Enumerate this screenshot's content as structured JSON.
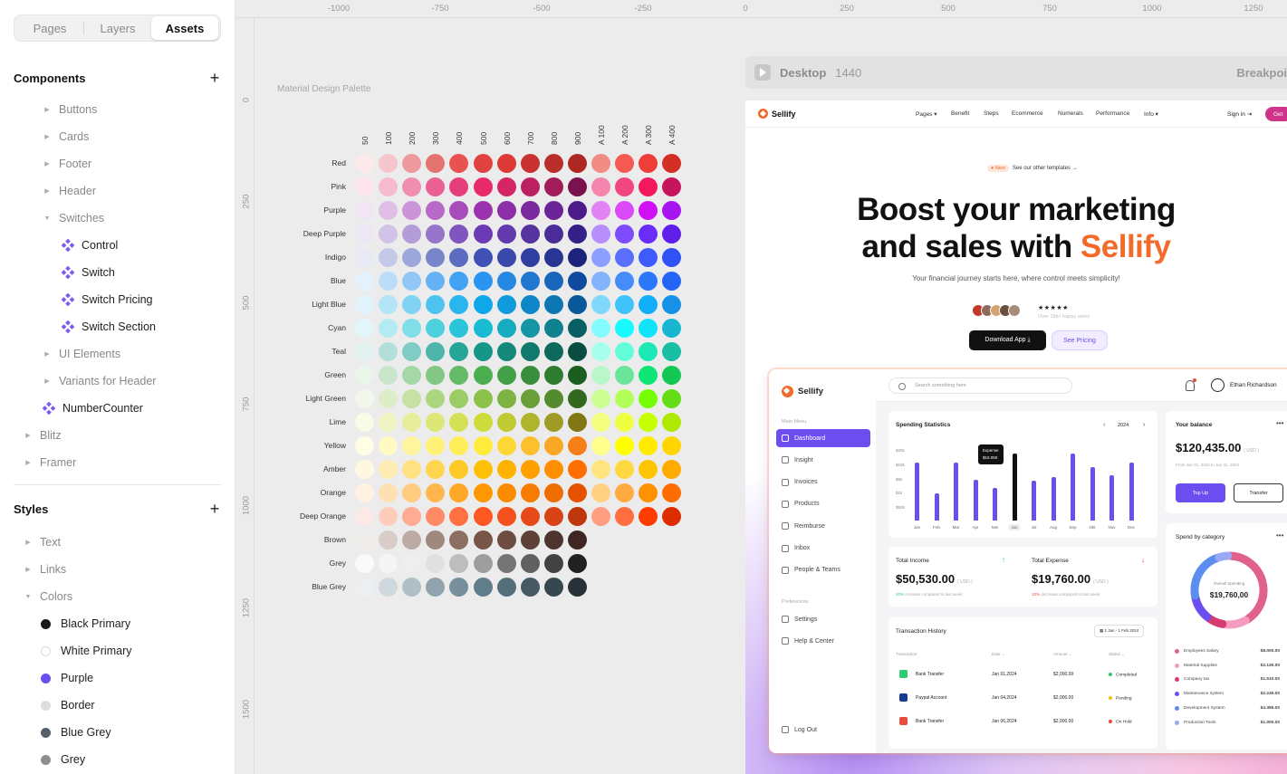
{
  "tabs": [
    "Pages",
    "Layers",
    "Assets"
  ],
  "active_tab": "Assets",
  "components": {
    "title": "Components",
    "items": [
      {
        "label": "Buttons"
      },
      {
        "label": "Cards"
      },
      {
        "label": "Footer"
      },
      {
        "label": "Header"
      },
      {
        "label": "Switches",
        "expanded": true
      },
      {
        "label": "Control"
      },
      {
        "label": "Switch"
      },
      {
        "label": "Switch Pricing"
      },
      {
        "label": "Switch Section"
      },
      {
        "label": "UI Elements"
      },
      {
        "label": "Variants for Header"
      },
      {
        "label": "NumberCounter"
      },
      {
        "label": "Blitz"
      },
      {
        "label": "Framer"
      }
    ]
  },
  "styles": {
    "title": "Styles",
    "items": [
      {
        "label": "Text"
      },
      {
        "label": "Links"
      },
      {
        "label": "Colors",
        "expanded": true
      },
      {
        "label": "Black Primary",
        "color": "#1a1a1a"
      },
      {
        "label": "White Primary",
        "color": "#ffffff"
      },
      {
        "label": "Purple",
        "color": "#6c4ef0"
      },
      {
        "label": "Border",
        "color": "#dedede"
      },
      {
        "label": "Blue Grey",
        "color": "#56606b"
      },
      {
        "label": "Grey",
        "color": "#8e8e8e"
      }
    ]
  },
  "ruler": {
    "top": [
      "-1000",
      "-750",
      "-500",
      "-250",
      "0",
      "250",
      "500",
      "750",
      "1000",
      "1250"
    ],
    "left": [
      "0",
      "250",
      "500",
      "750",
      "1000",
      "1250",
      "1500"
    ]
  },
  "palette": {
    "title": "Material Design Palette",
    "columns": [
      "50",
      "100",
      "200",
      "300",
      "400",
      "500",
      "600",
      "700",
      "800",
      "900",
      "A 100",
      "A 200",
      "A 300",
      "A 400"
    ],
    "rows": [
      {
        "name": "Red",
        "colors": [
          "#fde9ea",
          "#f5c6cb",
          "#ec9a9d",
          "#e47370",
          "#e8534f",
          "#e0433f",
          "#dd3935",
          "#c93231",
          "#b92e2b",
          "#ad2823",
          "#f08c84",
          "#f55a52",
          "#ef3e3a",
          "#d42f24"
        ]
      },
      {
        "name": "Pink",
        "colors": [
          "#fce3ec",
          "#f6bbd0",
          "#f08eb0",
          "#ea6093",
          "#e63d7c",
          "#e62a6a",
          "#d42565",
          "#bc2060",
          "#a31b59",
          "#79124d",
          "#f585ac",
          "#f1467e",
          "#f2195f",
          "#c6155c"
        ]
      },
      {
        "name": "Purple",
        "colors": [
          "#f1e4f4",
          "#e0bee6",
          "#cc94d8",
          "#b76ac7",
          "#a84cbb",
          "#9a33ad",
          "#8b2ea8",
          "#7a299f",
          "#6a2498",
          "#4d1a89",
          "#e382f5",
          "#db49f8",
          "#d10ff5",
          "#a814f1"
        ]
      },
      {
        "name": "Deep Purple",
        "colors": [
          "#ece6f5",
          "#d0c3e7",
          "#b39cd8",
          "#9575ca",
          "#7f56c0",
          "#6b3ab4",
          "#623aae",
          "#56339f",
          "#4b2d99",
          "#351f89",
          "#b78efc",
          "#7d4cfb",
          "#6a2cf8",
          "#5f1eea"
        ]
      },
      {
        "name": "Indigo",
        "colors": [
          "#e7e9f5",
          "#c4c9e8",
          "#9ea7d9",
          "#7985cb",
          "#5d6bc0",
          "#3f51b5",
          "#3a48ab",
          "#303f9f",
          "#283593",
          "#1b237d",
          "#8c9eff",
          "#5a6ffc",
          "#3d5bfe",
          "#3051f5"
        ]
      },
      {
        "name": "Blue",
        "colors": [
          "#e3f1fd",
          "#bcdcf9",
          "#91c7f7",
          "#64b2f4",
          "#42a2f3",
          "#2a94f2",
          "#2588e3",
          "#1f77d0",
          "#1966bd",
          "#104a9e",
          "#83b3fc",
          "#458cfa",
          "#2a79fc",
          "#2564f6"
        ]
      },
      {
        "name": "Light Blue",
        "colors": [
          "#e1f4fb",
          "#b3e4f7",
          "#80d3f3",
          "#4fc3f0",
          "#29b5ed",
          "#0ea8ea",
          "#0f9adb",
          "#0d87c7",
          "#0c77b3",
          "#08589a",
          "#80d7fc",
          "#3fc3fb",
          "#12aef8",
          "#1691e8"
        ]
      },
      {
        "name": "Cyan",
        "colors": [
          "#e0f6f8",
          "#b2ebf1",
          "#80dee8",
          "#4fd0df",
          "#2ac5d8",
          "#17bbd2",
          "#16abbf",
          "#1496a6",
          "#10828e",
          "#085f64",
          "#84fcfe",
          "#19fafe",
          "#11e3fb",
          "#17b7d1"
        ]
      },
      {
        "name": "Teal",
        "colors": [
          "#e1f2f1",
          "#b3dfdb",
          "#80cbc4",
          "#4eb5ab",
          "#26a699",
          "#149688",
          "#13887b",
          "#10796b",
          "#0d695c",
          "#084d40",
          "#a7ffeb",
          "#64fdda",
          "#1de9b6",
          "#18bfa5"
        ]
      },
      {
        "name": "Green",
        "colors": [
          "#e8f5e9",
          "#c9e6ca",
          "#a5d7a7",
          "#82c784",
          "#66bb69",
          "#4caf4f",
          "#43a046",
          "#398e3c",
          "#2e7d31",
          "#1b5e1f",
          "#b9f6ca",
          "#6ae59a",
          "#10e676",
          "#12c853"
        ]
      },
      {
        "name": "Light Green",
        "colors": [
          "#f2f8e9",
          "#ddedc8",
          "#c5e1a4",
          "#acd580",
          "#9ccc66",
          "#8bc34a",
          "#7db342",
          "#689f38",
          "#548b2e",
          "#33691e",
          "#ccff91",
          "#b2ff59",
          "#76ff03",
          "#64dd17"
        ]
      },
      {
        "name": "Lime",
        "colors": [
          "#f9fbe6",
          "#f0f4c3",
          "#e6ee9b",
          "#dce775",
          "#d4e157",
          "#cddc39",
          "#c0ca33",
          "#afb42b",
          "#9e9c24",
          "#817716",
          "#f4ff81",
          "#eeff41",
          "#c6ff00",
          "#aeea00"
        ]
      },
      {
        "name": "Yellow",
        "colors": [
          "#fffde6",
          "#fff9c4",
          "#fff59c",
          "#fff176",
          "#ffee58",
          "#ffeb3c",
          "#fdd835",
          "#fbc02d",
          "#f9a825",
          "#f57f16",
          "#ffff8d",
          "#ffff00",
          "#ffea00",
          "#ffd600"
        ]
      },
      {
        "name": "Amber",
        "colors": [
          "#fff8e1",
          "#ffecb3",
          "#ffe083",
          "#ffd54f",
          "#ffca28",
          "#ffc107",
          "#ffb300",
          "#ffa000",
          "#ff8f00",
          "#ff6f00",
          "#ffe57f",
          "#ffd740",
          "#ffc400",
          "#ffab00"
        ]
      },
      {
        "name": "Orange",
        "colors": [
          "#fff2e0",
          "#ffe0b2",
          "#ffcc80",
          "#ffb74d",
          "#ffa726",
          "#ff9800",
          "#fb8c00",
          "#f57c00",
          "#ef6c00",
          "#e65100",
          "#ffd180",
          "#ffab40",
          "#ff9100",
          "#ff6d00"
        ]
      },
      {
        "name": "Deep Orange",
        "colors": [
          "#fbe9e7",
          "#ffccbc",
          "#ffab91",
          "#ff8a65",
          "#ff7043",
          "#ff5722",
          "#f4511e",
          "#e64a19",
          "#d84315",
          "#bf360c",
          "#ff9e80",
          "#ff6e40",
          "#ff3d00",
          "#dd2c00"
        ]
      },
      {
        "name": "Brown",
        "colors": [
          "#efebe9",
          "#d7ccc8",
          "#bcaaa4",
          "#a1887f",
          "#8d6e63",
          "#795548",
          "#6d4c41",
          "#5d4037",
          "#4e342e",
          "#3e2723"
        ]
      },
      {
        "name": "Grey",
        "colors": [
          "#fafafa",
          "#f5f5f5",
          "#eeeeee",
          "#e0e0e0",
          "#bdbdbd",
          "#9e9e9e",
          "#757575",
          "#616161",
          "#424242",
          "#212121"
        ]
      },
      {
        "name": "Blue Grey",
        "colors": [
          "#eceff1",
          "#cfd8dc",
          "#b0bec5",
          "#90a4ae",
          "#78909c",
          "#607d8b",
          "#546e7a",
          "#455a64",
          "#37474f",
          "#263238"
        ]
      }
    ]
  },
  "frame": {
    "name": "Desktop",
    "size": "1440",
    "breakpoint": "Breakpoi"
  },
  "site": {
    "brand": "Sellify",
    "nav": [
      "Pages ▾",
      "Benefit",
      "Steps",
      "Ecommerce",
      "Numerals",
      "Performance",
      "Info ▾"
    ],
    "signin": "Sign in",
    "cta": "Get",
    "new_tag": "New",
    "new_text": "See our other templates →",
    "hero_line1": "Boost your marketing",
    "hero_line2_pre": "and sales with ",
    "hero_line2_accent": "Sellify",
    "subtitle": "Your financial journey starts here, where control meets simplicity!",
    "stars": "★★★★★",
    "happy": "Over 18k+ happy users",
    "download": "Download App ⤓",
    "pricing": "See Pricing",
    "avatar_colors": [
      "#c0392b",
      "#8e6a5a",
      "#d4a373",
      "#6b4f3f",
      "#a88b79"
    ]
  },
  "dashboard": {
    "brand": "Sellify",
    "main_menu": "Main Menu",
    "menu": [
      "Dashboard",
      "Insight",
      "Invoices",
      "Products",
      "Reimburse",
      "Inbox",
      "People & Teams"
    ],
    "preferences": "Preferences",
    "pref_menu": [
      "Settings",
      "Help & Center"
    ],
    "logout": "Log Out",
    "search": "Search something here",
    "user": "Ethan Richardson",
    "spending": {
      "title": "Spending Statistics",
      "year": "2024",
      "tooltip_label": "Expense",
      "tooltip_value": "$15.050",
      "ylabels": [
        "$25k",
        "$10k",
        "$5k",
        "$1k",
        "$500"
      ]
    },
    "balance": {
      "title": "Your balance",
      "value": "$120,435.00",
      "currency": "( USD )",
      "range": "From Jan 01, 2024 to Jan 31, 2024",
      "topup": "Top Up",
      "transfer": "Transfer"
    },
    "income": {
      "title": "Total Income",
      "value": "$50,530.00",
      "currency": "( USD )",
      "pct": "20%",
      "note": "increase compared to last week"
    },
    "expense": {
      "title": "Total Expense",
      "value": "$19,760.00",
      "currency": "( USD )",
      "pct": "10%",
      "note": "decrease compared to last week"
    },
    "transactions": {
      "title": "Transaction History",
      "range": "1 Jan - 1 Feb 2024",
      "headers": [
        "Transaction",
        "Date ⌄",
        "Amount ⌄",
        "Status ⌄"
      ],
      "rows": [
        {
          "name": "Bank Transfer",
          "date": "Jan 01,2024",
          "amount": "$2,000.00",
          "status": "Completed",
          "color": "#2ecc71"
        },
        {
          "name": "Paypal Account",
          "date": "Jan 04,2024",
          "amount": "$2,000.00",
          "status": "Pending",
          "color": "#f1c40f"
        },
        {
          "name": "Bank Transfer",
          "date": "Jan 06,2024",
          "amount": "$2,000.00",
          "status": "On Hold",
          "color": "#e74c3c"
        }
      ]
    },
    "category": {
      "title": "Spend by category",
      "center_label": "Overall Spending",
      "center_value": "$19,760,00",
      "items": [
        {
          "label": "Employees Salary",
          "amount": "$8.000.00",
          "color": "#e0608e"
        },
        {
          "label": "Material Supplies",
          "amount": "$2.130.00",
          "color": "#f49bbf"
        },
        {
          "label": "Company tax",
          "amount": "$1.510.00",
          "color": "#d43c6f"
        },
        {
          "label": "Maintenance system",
          "amount": "$2.245.00",
          "color": "#6c4ef0"
        },
        {
          "label": "Development System",
          "amount": "$4.385.00",
          "color": "#5b8ef0"
        },
        {
          "label": "Production Tools",
          "amount": "$1.000.00",
          "color": "#9aa8f5"
        }
      ]
    },
    "chart_data": {
      "type": "bar",
      "categories": [
        "Jan",
        "Feb",
        "Mar",
        "Apr",
        "Mei",
        "Jun",
        "Jul",
        "Aug",
        "Sep",
        "Okt",
        "Nov",
        "Dec"
      ],
      "values": [
        0.84,
        0.39,
        0.84,
        0.59,
        0.47,
        0.97,
        0.58,
        0.63,
        0.97,
        0.78,
        0.66,
        0.84
      ]
    }
  }
}
